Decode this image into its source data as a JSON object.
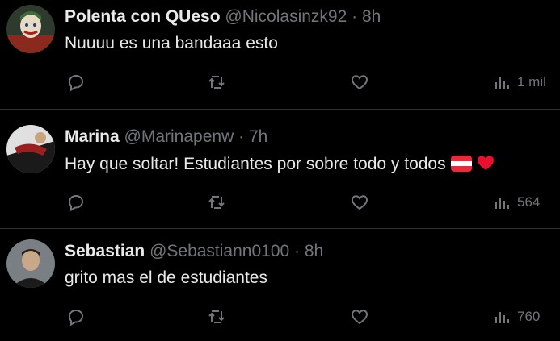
{
  "tweets": [
    {
      "name": "Polenta con QUeso",
      "handle": "@Nicolasinzk92",
      "sep": "·",
      "time": "8h",
      "text": "Nuuuu es una bandaaa esto",
      "views": "1 mil",
      "avatar_colors": [
        "#3b4a3a",
        "#b83a2a",
        "#e8d7b0"
      ]
    },
    {
      "name": "Marina",
      "handle": "@Marinapenw",
      "sep": "·",
      "time": "7h",
      "text": "Hay que soltar! Estudiantes por sobre todo y todos",
      "emoji": [
        "flag-austria-icon",
        "red-heart-icon"
      ],
      "views": "564",
      "avatar_colors": [
        "#d8d8d8",
        "#8b1e1e",
        "#222"
      ]
    },
    {
      "name": "Sebastian",
      "handle": "@Sebastiann0100",
      "sep": "·",
      "time": "8h",
      "text": "grito mas el de estudiantes",
      "views": "760",
      "avatar_colors": [
        "#6b6f73",
        "#1c1c1c",
        "#c9a88a"
      ]
    }
  ],
  "colors": {
    "background": "#000000",
    "text": "#e7e9ea",
    "muted": "#71767b",
    "divider": "#2f3336",
    "heart": "#f91880",
    "flag_red": "#ed2939"
  }
}
